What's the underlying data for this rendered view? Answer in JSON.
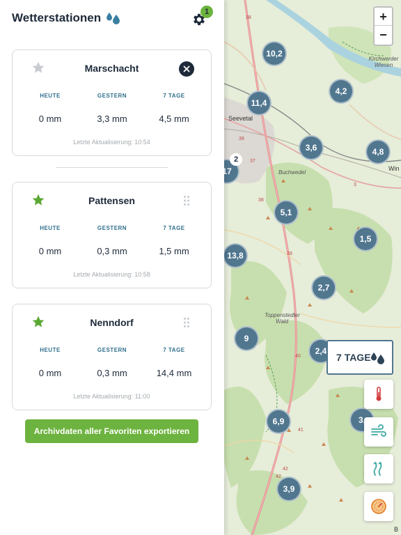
{
  "header": {
    "title": "Wetterstationen",
    "settings_badge": "1"
  },
  "columns": [
    "HEUTE",
    "GESTERN",
    "7 TAGE"
  ],
  "stations": [
    {
      "name": "Marschacht",
      "favorite": false,
      "today": "0 mm",
      "yesterday": "3,3 mm",
      "week": "4,5 mm",
      "updated": "Letzte Aktualisierung: 10:54"
    },
    {
      "name": "Pattensen",
      "favorite": true,
      "today": "0 mm",
      "yesterday": "0,3 mm",
      "week": "1,5 mm",
      "updated": "Letzte Aktualisierung: 10:58"
    },
    {
      "name": "Nenndorf",
      "favorite": true,
      "today": "0 mm",
      "yesterday": "0,3 mm",
      "week": "14,4 mm",
      "updated": "Letzte Aktualisierung: 11:00"
    }
  ],
  "export_button": "Archivdaten aller Favoriten exportieren",
  "map": {
    "zoom_in": "+",
    "zoom_out": "−",
    "period_label": "7 TAGE",
    "cluster_badge": "2",
    "clusters": [
      "10,2",
      "4,2",
      "11,4",
      "3,6",
      "4,8",
      "17",
      "5,1",
      "1,5",
      "13,8",
      "2,7",
      "9",
      "2,4",
      "6,9",
      "3,",
      "3,9"
    ],
    "places": {
      "seevetal": "Seevetal",
      "buchwedel": "Buchwedel",
      "toppenstedter_wald": "Toppenstedter Wald",
      "kirchwerder_wiesen": "Kirchwerder Wiesen",
      "win": "Win",
      "b": "B"
    },
    "road_numbers": [
      "38",
      "39",
      "37",
      "38",
      "39",
      "40",
      "41",
      "42",
      "42",
      "3"
    ]
  },
  "colors": {
    "accent_green": "#6db33f",
    "cluster_blue": "#51778f",
    "dark_navy": "#1e2a3a",
    "label_blue": "#2f6f8c"
  },
  "icons": {
    "title": "water-drops-icon",
    "settings": "gear-icon",
    "star": "star-icon",
    "close": "close-icon",
    "drag": "drag-handle-icon",
    "temperature": "thermometer-icon",
    "wind": "wind-icon",
    "humidity": "heat-waves-icon",
    "pressure": "gauge-icon"
  }
}
